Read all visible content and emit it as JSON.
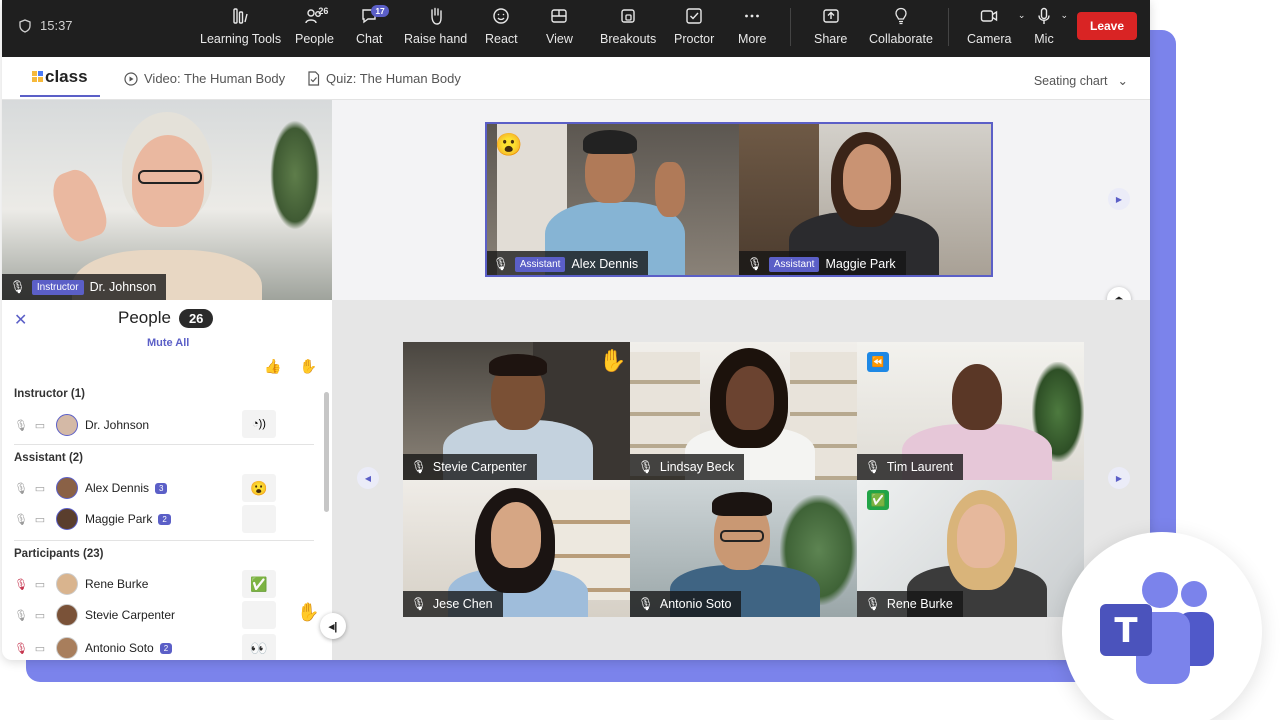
{
  "topbar": {
    "time": "15:37",
    "buttons": [
      {
        "label": "Learning Tools",
        "icon": "learning-tools-icon"
      },
      {
        "label": "People",
        "icon": "people-icon",
        "count": "26"
      },
      {
        "label": "Chat",
        "icon": "chat-icon",
        "badge": "17"
      },
      {
        "label": "Raise hand",
        "icon": "raise-hand-icon"
      },
      {
        "label": "React",
        "icon": "react-icon"
      },
      {
        "label": "View",
        "icon": "view-icon"
      },
      {
        "label": "Breakouts",
        "icon": "breakouts-icon"
      },
      {
        "label": "Proctor",
        "icon": "proctor-icon"
      },
      {
        "label": "More",
        "icon": "more-icon"
      },
      {
        "label": "Share",
        "icon": "share-icon"
      },
      {
        "label": "Collaborate",
        "icon": "collaborate-icon"
      },
      {
        "label": "Camera",
        "icon": "camera-icon"
      },
      {
        "label": "Mic",
        "icon": "mic-icon"
      }
    ],
    "leave": "Leave"
  },
  "tabs": {
    "logo": "class",
    "video": "Video: The Human Body",
    "quiz": "Quiz: The Human Body",
    "seating": "Seating chart"
  },
  "instructor": {
    "role": "Instructor",
    "name": "Dr. Johnson"
  },
  "people": {
    "title": "People",
    "count": "26",
    "mute_all": "Mute All",
    "instructor_section": "Instructor (1)",
    "assistant_section": "Assistant (2)",
    "participants_section": "Participants (23)",
    "instructor_rows": [
      {
        "name": "Dr. Johnson",
        "status": "speaking"
      }
    ],
    "assistant_rows": [
      {
        "name": "Alex Dennis",
        "chat": "3",
        "status": "😮"
      },
      {
        "name": "Maggie Park",
        "chat": "2",
        "status": ""
      }
    ],
    "participant_rows": [
      {
        "name": "Rene Burke",
        "chat": "",
        "status": "✅",
        "muted": true
      },
      {
        "name": "Stevie Carpenter",
        "chat": "",
        "status": "",
        "hand": "✋",
        "muted": false
      },
      {
        "name": "Antonio Soto",
        "chat": "2",
        "status": "👀",
        "muted": true
      }
    ]
  },
  "assistants": [
    {
      "role": "Assistant",
      "name": "Alex Dennis",
      "reaction": "😮"
    },
    {
      "role": "Assistant",
      "name": "Maggie Park"
    }
  ],
  "grid": [
    {
      "name": "Stevie Carpenter",
      "badge": "✋"
    },
    {
      "name": "Lindsay Beck"
    },
    {
      "name": "Tim Laurent",
      "badge": "⏪"
    },
    {
      "name": "Jese Chen"
    },
    {
      "name": "Antonio Soto"
    },
    {
      "name": "Rene Burke",
      "badge": "✅"
    }
  ],
  "colors": {
    "accent": "#5b5fc7",
    "leave": "#d92424",
    "frame": "#7b83eb"
  }
}
